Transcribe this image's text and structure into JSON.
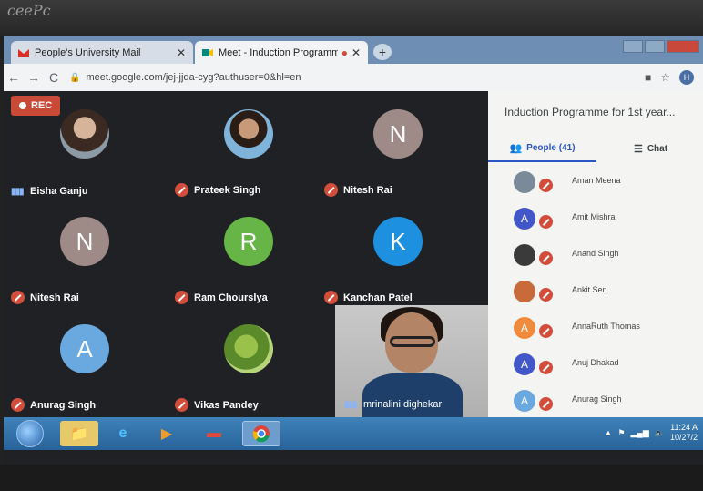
{
  "browser": {
    "tabs": [
      {
        "label": "People's University Mail",
        "favicon": "gmail-icon"
      },
      {
        "label": "Meet - Induction Programme",
        "favicon": "meet-icon"
      }
    ],
    "url": "meet.google.com/jej-jjda-cyg?authuser=0&hl=en",
    "profile_initial": "H"
  },
  "meet": {
    "rec_label": "REC",
    "participants": [
      {
        "name": "Eisha Ganju",
        "avatar": "photo",
        "speaking": true
      },
      {
        "name": "Prateek Singh",
        "avatar": "photo2",
        "speaking": false
      },
      {
        "name": "Nitesh Rai",
        "avatar": "initial",
        "initial": "N",
        "color": "#9e8a86",
        "speaking": false
      },
      {
        "name": "Nitesh Rai",
        "avatar": "initial",
        "initial": "N",
        "color": "#9e8a86",
        "speaking": false
      },
      {
        "name": "Ram Chourslya",
        "avatar": "initial",
        "initial": "R",
        "color": "#67b546",
        "speaking": false
      },
      {
        "name": "Kanchan Patel",
        "avatar": "initial",
        "initial": "K",
        "color": "#1e90e0",
        "speaking": false
      },
      {
        "name": "Anurag Singh",
        "avatar": "initial",
        "initial": "A",
        "color": "#6aa9e0",
        "speaking": false
      },
      {
        "name": "Vikas Pandey",
        "avatar": "photo3",
        "speaking": false
      }
    ],
    "self": {
      "name": "mrinalini dighekar"
    }
  },
  "panel": {
    "title": "Induction Programme for 1st year...",
    "people_tab": "People (41)",
    "chat_tab": "Chat",
    "people": [
      {
        "name": "Aman Meena",
        "initial": "",
        "color": "#7a8a99"
      },
      {
        "name": "Amit Mishra",
        "initial": "A",
        "color": "#4056c9"
      },
      {
        "name": "Anand Singh",
        "initial": "",
        "color": "#3a3a3a"
      },
      {
        "name": "Ankit Sen",
        "initial": "",
        "color": "#c96a3a"
      },
      {
        "name": "AnnaRuth Thomas",
        "initial": "A",
        "color": "#f08a3c"
      },
      {
        "name": "Anuj Dhakad",
        "initial": "A",
        "color": "#4056c9"
      },
      {
        "name": "Anurag Singh",
        "initial": "A",
        "color": "#6aa9e0"
      }
    ]
  },
  "taskbar": {
    "time": "11:24 A",
    "date": "10/27/2"
  }
}
